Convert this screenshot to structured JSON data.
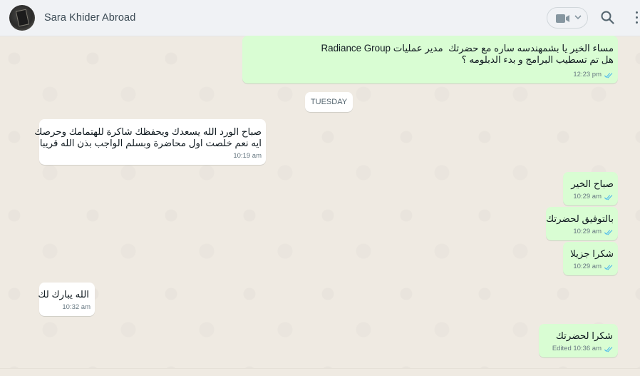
{
  "header": {
    "contact_name": "Sara Khider Abroad",
    "avatar_icon": "contact-avatar",
    "video_icon": "video-camera-icon",
    "search_icon": "search-icon",
    "menu_icon": "kebab-menu-icon"
  },
  "chat": {
    "date_separator": "TUESDAY",
    "messages": [
      {
        "direction": "outgoing",
        "lines": [
          "مساء الخير يا بشمهندسه ساره مع حضرتك  مدير عمليات Radiance Group",
          "هل تم تسطيب البرامج و بدء الدبلومه ؟"
        ],
        "time": "12:23 pm",
        "status": "read"
      },
      {
        "direction": "incoming",
        "lines": [
          "صباح الورد الله يسعدك ويحفظك شاكرة للهتمامك وحرصك",
          "ايه نعم خلصت اول محاضرة وبسلم الواجب بذن الله قريبا"
        ],
        "time": "10:19 am"
      },
      {
        "direction": "outgoing",
        "lines": [
          "صباح الخير"
        ],
        "time": "10:29 am",
        "status": "read"
      },
      {
        "direction": "outgoing",
        "lines": [
          "بالتوفيق لحضرتك"
        ],
        "time": "10:29 am",
        "status": "read"
      },
      {
        "direction": "outgoing",
        "lines": [
          "شكرا جزيلا"
        ],
        "time": "10:29 am",
        "status": "read"
      },
      {
        "direction": "incoming",
        "lines": [
          "الله يبارك لك"
        ],
        "time": "10:32 am"
      },
      {
        "direction": "outgoing",
        "lines": [
          "شكرا لحضرتك"
        ],
        "time": "Edited 10:36 am",
        "status": "read"
      }
    ]
  },
  "colors": {
    "outgoing_bubble": "#d9fdd3",
    "incoming_bubble": "#ffffff",
    "chat_background": "#efeae2",
    "read_ticks": "#53bdeb"
  }
}
